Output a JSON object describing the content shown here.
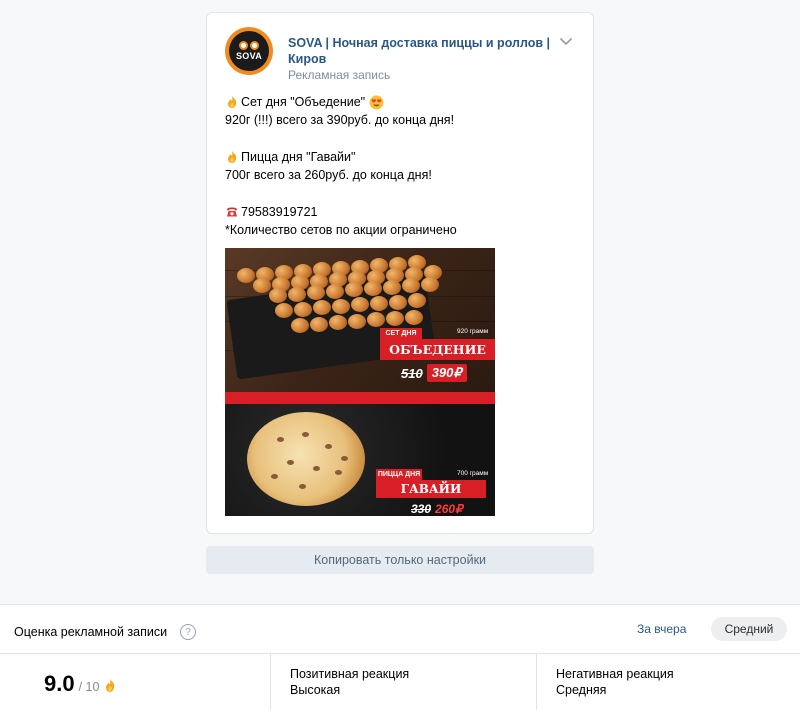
{
  "post": {
    "author": "SOVA | Ночная доставка пиццы и роллов | Киров",
    "subtitle": "Рекламная запись",
    "avatar_text": "SOVA",
    "lines": [
      {
        "emoji": "fire-emoji",
        "text": "Сет дня \"Объедение\"",
        "trailing_emoji": "heart-eyes-emoji"
      },
      {
        "text": "920г (!!!) всего за 390руб. до конца дня!"
      },
      {
        "text": ""
      },
      {
        "emoji": "fire-emoji",
        "text": "Пицца дня \"Гавайи\""
      },
      {
        "text": "700г всего за 260руб. до конца дня!"
      },
      {
        "text": ""
      },
      {
        "emoji": "phone-emoji",
        "text": "79583919721"
      },
      {
        "text": "*Количество сетов по акции ограничено"
      }
    ],
    "image": {
      "set_tag": "СЕТ ДНЯ",
      "set_weight": "920 грамм",
      "set_name": "ОБЪЕДЕНИЕ",
      "set_old_price": "510",
      "set_new_price": "390₽",
      "pizza_tag": "ПИЦЦА ДНЯ",
      "pizza_weight": "700 грамм",
      "pizza_name": "ГАВАЙИ",
      "pizza_old_price": "330",
      "pizza_new_price": "260₽"
    }
  },
  "copy_button_label": "Копировать только настройки",
  "rating": {
    "title": "Оценка рекламной записи",
    "help_icon": "?",
    "period": "За вчера",
    "level": "Средний",
    "score": "9.0",
    "score_max": "/ 10",
    "positive_label": "Позитивная реакция",
    "positive_value": "Высокая",
    "negative_label": "Негативная реакция",
    "negative_value": "Средняя"
  },
  "colors": {
    "link": "#2a5885",
    "promo_red": "#d81f26",
    "avatar_orange": "#f08c1e"
  }
}
